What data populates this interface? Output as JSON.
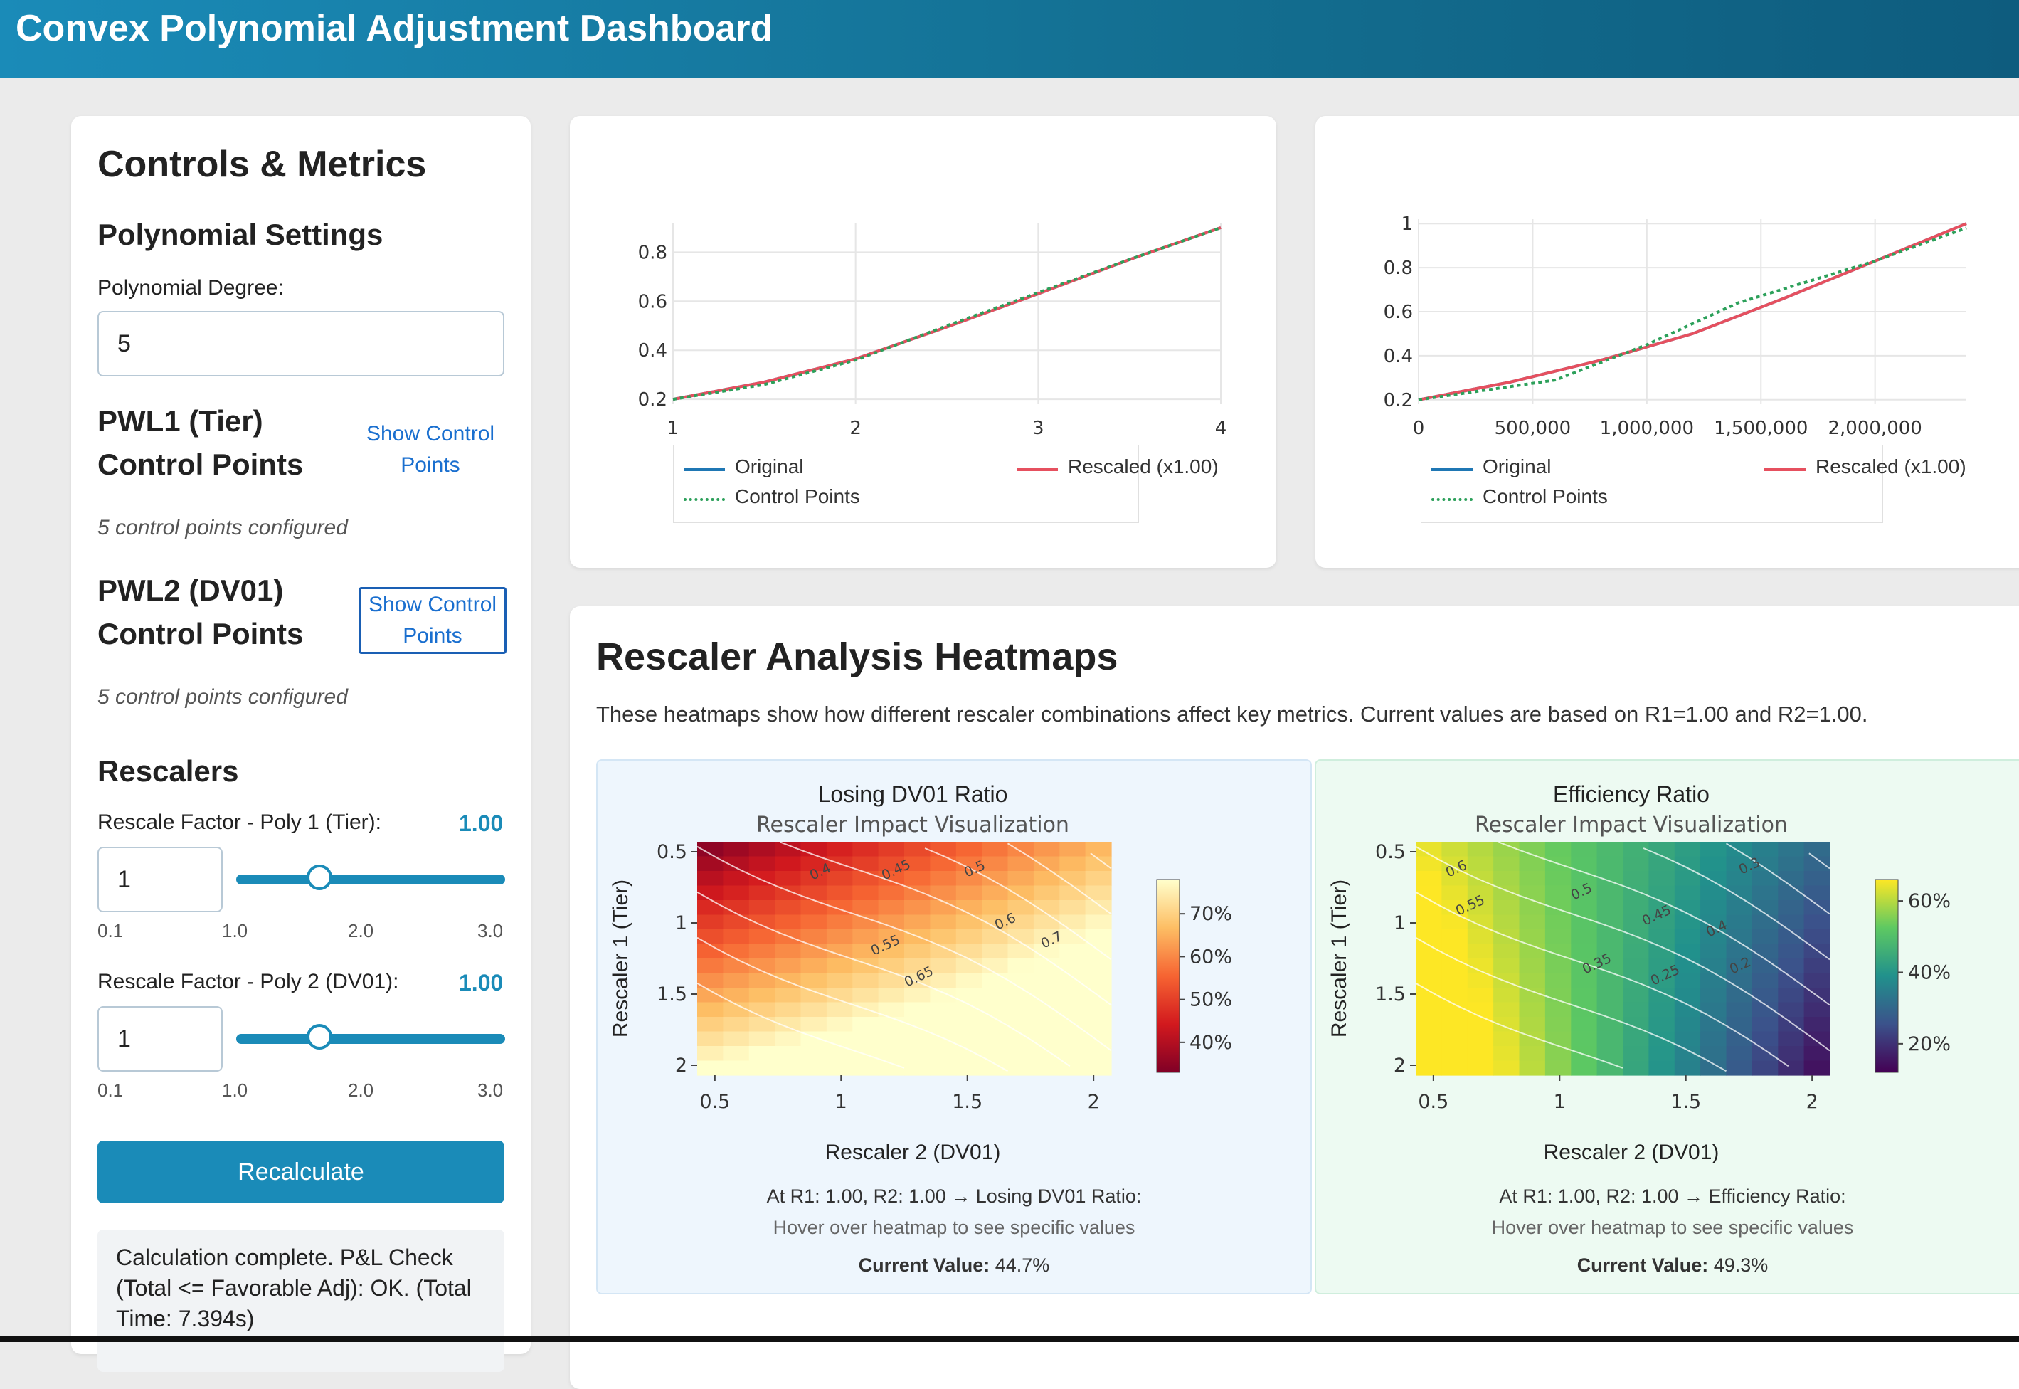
{
  "header": {
    "title": "Convex Polynomial Adjustment Dashboard"
  },
  "controls": {
    "title": "Controls & Metrics",
    "poly_section": "Polynomial Settings",
    "degree_label": "Polynomial Degree:",
    "degree_value": "5",
    "pwl1": {
      "title_line1": "PWL1 (Tier)",
      "title_line2": "Control Points",
      "button_line1": "Show Control",
      "button_line2": "Points",
      "note": "5 control points configured"
    },
    "pwl2": {
      "title_line1": "PWL2 (DV01)",
      "title_line2": "Control Points",
      "button_line1": "Show Control",
      "button_line2": "Points",
      "note": "5 control points configured"
    },
    "rescalers_title": "Rescalers",
    "r1": {
      "label": "Rescale Factor - Poly 1 (Tier):",
      "display": "1.00",
      "input": "1",
      "level": 1.0,
      "ticks": [
        "0.1",
        "1.0",
        "2.0",
        "3.0"
      ]
    },
    "r2": {
      "label": "Rescale Factor - Poly 2 (DV01):",
      "display": "1.00",
      "input": "1",
      "level": 1.0,
      "ticks": [
        "0.1",
        "1.0",
        "2.0",
        "3.0"
      ]
    },
    "recalc_label": "Recalculate",
    "status": "Calculation complete. P&L Check (Total <= Favorable Adj): OK. (Total Time: 7.394s)"
  },
  "colors": {
    "accent": "#1a8bb8",
    "original": "#1f77b4",
    "rescaled": "#e6505f",
    "control": "#2ca05a"
  },
  "chart_data": [
    {
      "type": "line",
      "xlim": [
        1,
        4
      ],
      "ylim": [
        0.18,
        0.92
      ],
      "xticks": [
        "1",
        "2",
        "3",
        "4"
      ],
      "yticks": [
        "0.2",
        "0.4",
        "0.6",
        "0.8"
      ],
      "legend": [
        "Original",
        "Rescaled (x1.00)",
        "Control Points"
      ],
      "series": [
        {
          "name": "Original",
          "x": [
            1,
            1.5,
            2,
            2.5,
            3,
            3.5,
            4
          ],
          "y": [
            0.2,
            0.27,
            0.365,
            0.495,
            0.63,
            0.77,
            0.9
          ]
        },
        {
          "name": "Rescaled (x1.00)",
          "x": [
            1,
            1.5,
            2,
            2.5,
            3,
            3.5,
            4
          ],
          "y": [
            0.2,
            0.27,
            0.365,
            0.495,
            0.63,
            0.77,
            0.9
          ]
        },
        {
          "name": "Control Points",
          "x": [
            1,
            1.5,
            2,
            2.5,
            3,
            3.5,
            4
          ],
          "y": [
            0.2,
            0.26,
            0.36,
            0.5,
            0.635,
            0.77,
            0.9
          ]
        }
      ]
    },
    {
      "type": "line",
      "xlim": [
        0,
        2400000
      ],
      "ylim": [
        0.18,
        1.02
      ],
      "xticks": [
        "0",
        "500,000",
        "1,000,000",
        "1,500,000",
        "2,000,000"
      ],
      "yticks": [
        "0.2",
        "0.4",
        "0.6",
        "0.8",
        "1"
      ],
      "legend": [
        "Original",
        "Rescaled (x1.00)",
        "Control Points"
      ],
      "series": [
        {
          "name": "Original",
          "x": [
            0,
            400000,
            800000,
            1200000,
            1600000,
            2000000,
            2400000
          ],
          "y": [
            0.2,
            0.28,
            0.38,
            0.5,
            0.66,
            0.83,
            1.0
          ]
        },
        {
          "name": "Rescaled (x1.00)",
          "x": [
            0,
            400000,
            800000,
            1200000,
            1600000,
            2000000,
            2400000
          ],
          "y": [
            0.2,
            0.28,
            0.38,
            0.5,
            0.66,
            0.83,
            1.0
          ]
        },
        {
          "name": "Control Points",
          "x": [
            0,
            600000,
            1000000,
            1400000,
            2000000,
            2400000
          ],
          "y": [
            0.2,
            0.29,
            0.45,
            0.64,
            0.83,
            0.98
          ]
        }
      ]
    }
  ],
  "heatmaps": {
    "title": "Rescaler Analysis Heatmaps",
    "description": "These heatmaps show how different rescaler combinations affect key metrics. Current values are based on R1=1.00 and R2=1.00.",
    "panels": [
      {
        "title": "Losing DV01 Ratio",
        "subtitle": "Rescaler Impact Visualization",
        "xlabel": "Rescaler 2 (DV01)",
        "ylabel": "Rescaler 1 (Tier)",
        "xticks": [
          "0.5",
          "1",
          "1.5",
          "2"
        ],
        "yticks": [
          "0.5",
          "1",
          "1.5",
          "2"
        ],
        "colorbar": [
          "70%",
          "60%",
          "50%",
          "40%"
        ],
        "contours": [
          "0.4",
          "0.45",
          "0.5",
          "0.55",
          "0.6",
          "0.65",
          "0.7"
        ],
        "range": [
          0.33,
          0.78
        ],
        "info_line": "At R1: 1.00, R2: 1.00 → Losing DV01 Ratio:",
        "hover": "Hover over heatmap to see specific values",
        "current_label": "Current Value:",
        "current_value": "44.7%"
      },
      {
        "title": "Efficiency Ratio",
        "subtitle": "Rescaler Impact Visualization",
        "xlabel": "Rescaler 2 (DV01)",
        "ylabel": "Rescaler 1 (Tier)",
        "xticks": [
          "0.5",
          "1",
          "1.5",
          "2"
        ],
        "yticks": [
          "0.5",
          "1",
          "1.5",
          "2"
        ],
        "colorbar": [
          "60%",
          "40%",
          "20%"
        ],
        "contours": [
          "0.6",
          "0.55",
          "0.5",
          "0.45",
          "0.4",
          "0.35",
          "0.3",
          "0.25",
          "0.2"
        ],
        "range": [
          0.12,
          0.66
        ],
        "info_line": "At R1: 1.00, R2: 1.00 → Efficiency Ratio:",
        "hover": "Hover over heatmap to see specific values",
        "current_label": "Current Value:",
        "current_value": "49.3%"
      }
    ]
  }
}
